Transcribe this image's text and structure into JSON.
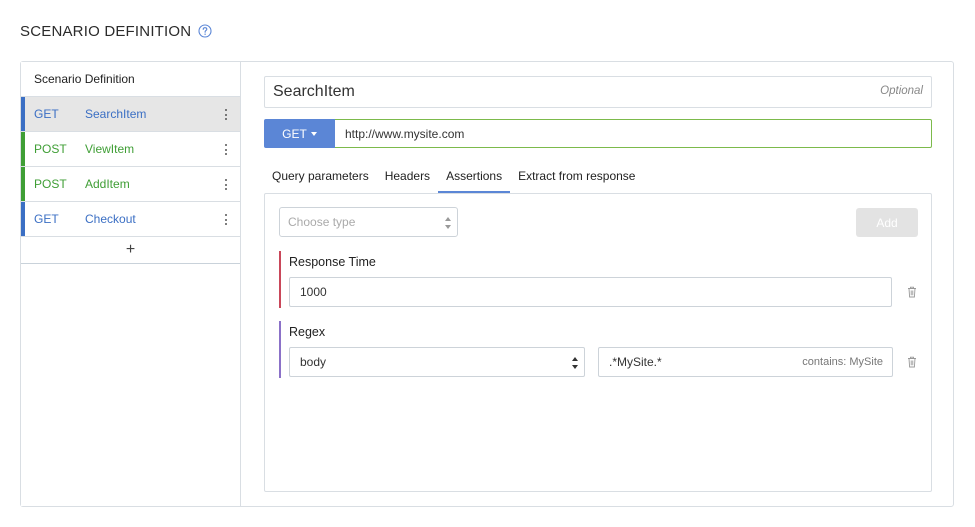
{
  "header": {
    "title": "SCENARIO DEFINITION"
  },
  "sidebar": {
    "title": "Scenario Definition",
    "add_label": "+",
    "items": [
      {
        "method": "GET",
        "name": "SearchItem",
        "active": true
      },
      {
        "method": "POST",
        "name": "ViewItem",
        "active": false
      },
      {
        "method": "POST",
        "name": "AddItem",
        "active": false
      },
      {
        "method": "GET",
        "name": "Checkout",
        "active": false
      }
    ]
  },
  "request": {
    "name": "SearchItem",
    "optional_label": "Optional",
    "method_label": "GET",
    "url": "http://www.mysite.com"
  },
  "tabs": [
    {
      "label": "Query parameters",
      "active": false
    },
    {
      "label": "Headers",
      "active": false
    },
    {
      "label": "Assertions",
      "active": true
    },
    {
      "label": "Extract from response",
      "active": false
    }
  ],
  "assertions_panel": {
    "type_placeholder": "Choose type",
    "add_label": "Add",
    "response_time": {
      "title": "Response Time",
      "value": "1000"
    },
    "regex": {
      "title": "Regex",
      "source_value": "body",
      "pattern_value": ".*MySite.*",
      "hint": "contains: MySite"
    }
  },
  "colors": {
    "get": "#3b6fc4",
    "post": "#3f9e35",
    "accent": "#5b86d6",
    "url_border": "#7cba4b",
    "response_time_bar": "#c9475a",
    "regex_bar": "#8b71c8"
  }
}
